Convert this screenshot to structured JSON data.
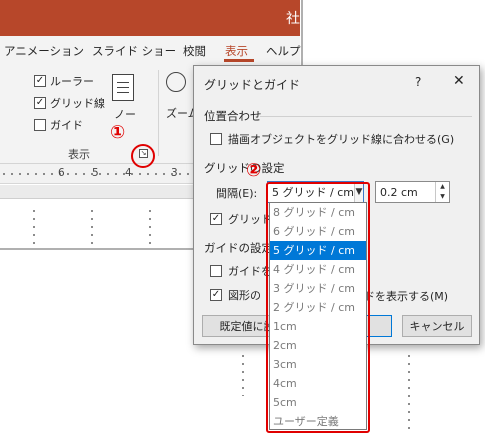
{
  "powerpoint": {
    "title_fragment": "社",
    "tabs": [
      {
        "label": "アニメーション"
      },
      {
        "label": "スライド ショー"
      },
      {
        "label": "校閲"
      },
      {
        "label": "表示",
        "active": true
      },
      {
        "label": "ヘルプ"
      }
    ],
    "ribbon": {
      "show_group": {
        "label": "表示",
        "checkboxes": [
          {
            "label": "ルーラー",
            "checked": true
          },
          {
            "label": "グリッド線",
            "checked": true
          },
          {
            "label": "ガイド",
            "checked": false
          }
        ],
        "launcher_icon": "dialog-launcher-icon"
      },
      "notes_label": "ノー",
      "zoom_label": "ズーム"
    },
    "ruler": {
      "numbers": [
        "6",
        "5",
        "4",
        "3"
      ]
    }
  },
  "annotations": {
    "marker1": "①",
    "marker2": "②",
    "color": "#e00000"
  },
  "dialog": {
    "title": "グリッドとガイド",
    "help": "?",
    "close": "✕",
    "snap_section": "位置合わせ",
    "snap_label": "描画オブジェクトをグリッド線に合わせる(G)",
    "snap_checked": false,
    "grid_section": "グリッドの設定",
    "spacing_label": "間隔(E):",
    "spacing_value": "5 グリッド / cm",
    "spacing_cm": "0.2 cm",
    "show_grid_label": "グリッド線",
    "show_grid_checked": true,
    "guide_section": "ガイドの設定",
    "guide_label": "ガイドを",
    "guide_checked": false,
    "smart_guide_label_left": "図形の",
    "smart_guide_label_right": "ドを表示する(M)",
    "smart_guide_checked": true,
    "default_button": "既定値に設",
    "cancel_button": "キャンセル",
    "accent": "#0078d7"
  },
  "dropdown": {
    "options": [
      "8 グリッド / cm",
      "6 グリッド / cm",
      "5 グリッド / cm",
      "4 グリッド / cm",
      "3 グリッド / cm",
      "2 グリッド / cm",
      "1cm",
      "2cm",
      "3cm",
      "4cm",
      "5cm",
      "ユーザー定義"
    ],
    "selected": "5 グリッド / cm"
  }
}
